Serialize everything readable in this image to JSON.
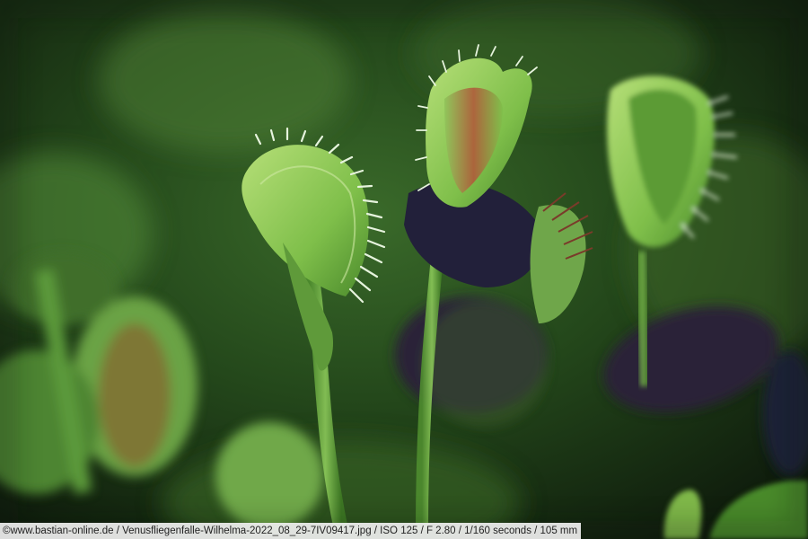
{
  "image": {
    "subject": "Venus flytrap (Dionaea muscipula) traps with green lobes and white-green teeth against a blurred green background",
    "caption": "©www.bastian-online.de / Venusfliegenfalle-Wilhelma-2022_08_29-7IV09417.jpg / ISO 125 / F 2.80 / 1/160 seconds  / 105 mm"
  },
  "colors": {
    "background_dark": "#0e1a0c",
    "background_mid": "#2f5a22",
    "leaf_green": "#7fbf4a",
    "leaf_light": "#b6df78",
    "trap_inner_red": "#b05a3a",
    "shadow_purple": "#2a2238",
    "teeth": "#e6f3dd"
  }
}
